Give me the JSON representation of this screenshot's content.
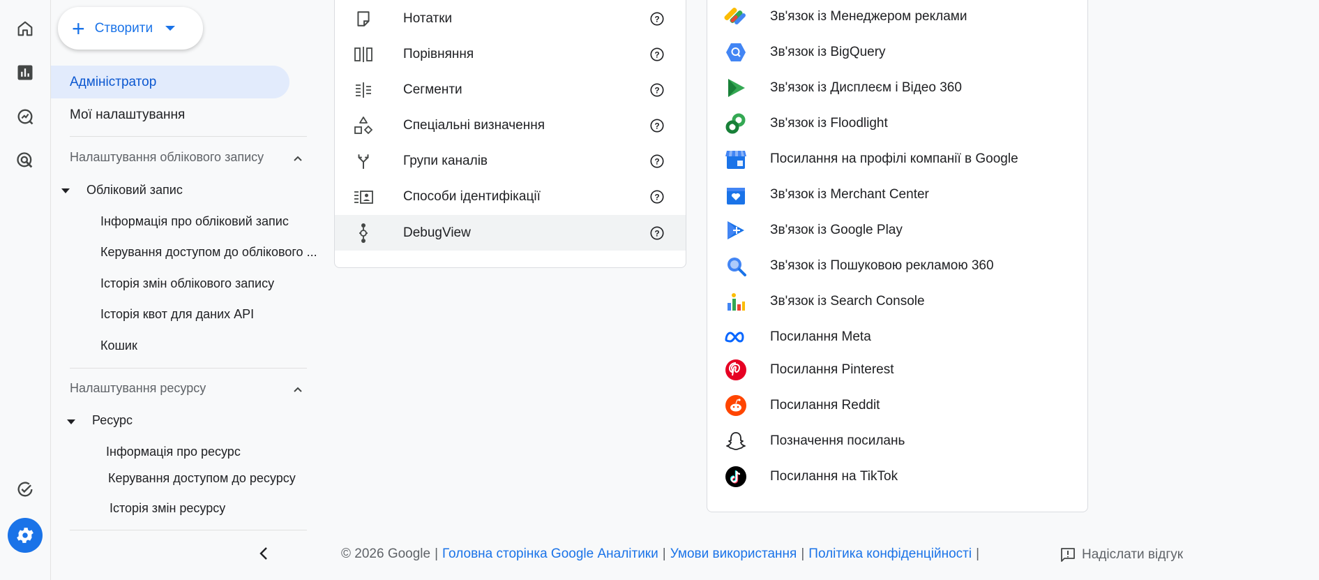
{
  "create_button": {
    "label": "Створити"
  },
  "nav": {
    "active_item": "Адміністратор",
    "my_settings": "Мої налаштування",
    "account_section": {
      "title": "Налаштування облікового запису",
      "group": "Обліковий запис",
      "items": [
        "Інформація про обліковий запис",
        "Керування доступом до облікового ...",
        "Історія змін облікового запису",
        "Історія квот для даних API",
        "Кошик"
      ]
    },
    "property_section": {
      "title": "Налаштування ресурсу",
      "group": "Ресурс",
      "items": [
        "Інформація про ресурс",
        "Керування доступом до ресурсу",
        "Історія змін ресурсу"
      ]
    }
  },
  "middle_card": {
    "items": [
      {
        "label": "Нотатки",
        "icon": "notes-icon"
      },
      {
        "label": "Порівняння",
        "icon": "comparison-icon"
      },
      {
        "label": "Сегменти",
        "icon": "segments-icon"
      },
      {
        "label": "Спеціальні визначення",
        "icon": "shapes-icon"
      },
      {
        "label": "Групи каналів",
        "icon": "channel-groups-icon"
      },
      {
        "label": "Способи ідентифікації",
        "icon": "identity-icon"
      },
      {
        "label": "DebugView",
        "icon": "debugview-icon"
      }
    ]
  },
  "right_card": {
    "items": [
      {
        "label": "Зв'язок із Менеджером реклами",
        "icon": "google-ads-icon"
      },
      {
        "label": "Зв'язок із BigQuery",
        "icon": "bigquery-icon"
      },
      {
        "label": "Зв'язок із Дисплеєм і Відео 360",
        "icon": "dv360-icon"
      },
      {
        "label": "Зв'язок із Floodlight",
        "icon": "floodlight-icon"
      },
      {
        "label": "Посилання на профілі компанії в Google",
        "icon": "business-profile-icon"
      },
      {
        "label": "Зв'язок із Merchant Center",
        "icon": "merchant-center-icon"
      },
      {
        "label": "Зв'язок із Google Play",
        "icon": "google-play-icon"
      },
      {
        "label": "Зв'язок із Пошуковою рекламою 360",
        "icon": "search-ads-360-icon"
      },
      {
        "label": "Зв'язок із Search Console",
        "icon": "search-console-icon"
      },
      {
        "label": "Посилання Meta",
        "icon": "meta-icon"
      },
      {
        "label": "Посилання Pinterest",
        "icon": "pinterest-icon"
      },
      {
        "label": "Посилання Reddit",
        "icon": "reddit-icon"
      },
      {
        "label": "Позначення посилань",
        "icon": "snapchat-icon"
      },
      {
        "label": "Посилання на TikTok",
        "icon": "tiktok-icon"
      }
    ]
  },
  "footer": {
    "copyright": "© 2026 Google",
    "links": [
      "Головна сторінка Google Аналітики",
      "Умови використання",
      "Політика конфіденційності"
    ],
    "feedback": "Надіслати відгук"
  },
  "colors": {
    "accent": "#1a73e8",
    "active_bg": "#e2ebfc",
    "card_border": "#dadce0",
    "background": "#f8f9fa"
  }
}
